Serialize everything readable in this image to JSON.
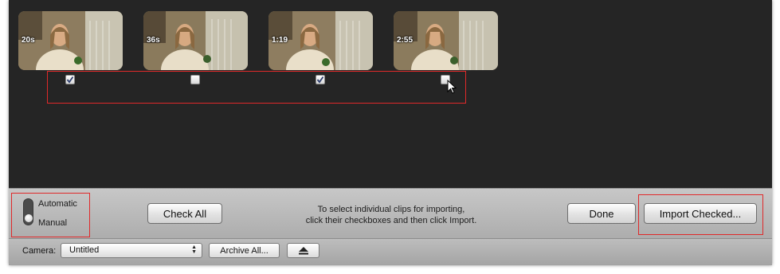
{
  "clips": [
    {
      "duration": "20s",
      "checked": true
    },
    {
      "duration": "36s",
      "checked": false
    },
    {
      "duration": "1:19",
      "checked": true
    },
    {
      "duration": "2:55",
      "checked": false
    }
  ],
  "import_mode": {
    "options": [
      "Automatic",
      "Manual"
    ],
    "selected": "Manual"
  },
  "toolbar": {
    "check_all_label": "Check All",
    "hint_line1": "To select individual clips for importing,",
    "hint_line2": "click their checkboxes and then click Import.",
    "done_label": "Done",
    "import_checked_label": "Import Checked..."
  },
  "statusbar": {
    "camera_label": "Camera:",
    "camera_selected": "Untitled",
    "archive_all_label": "Archive All...",
    "eject_icon": "eject-icon"
  },
  "colors": {
    "highlight": "#e0292a",
    "check_mark": "#2f3f6f"
  }
}
